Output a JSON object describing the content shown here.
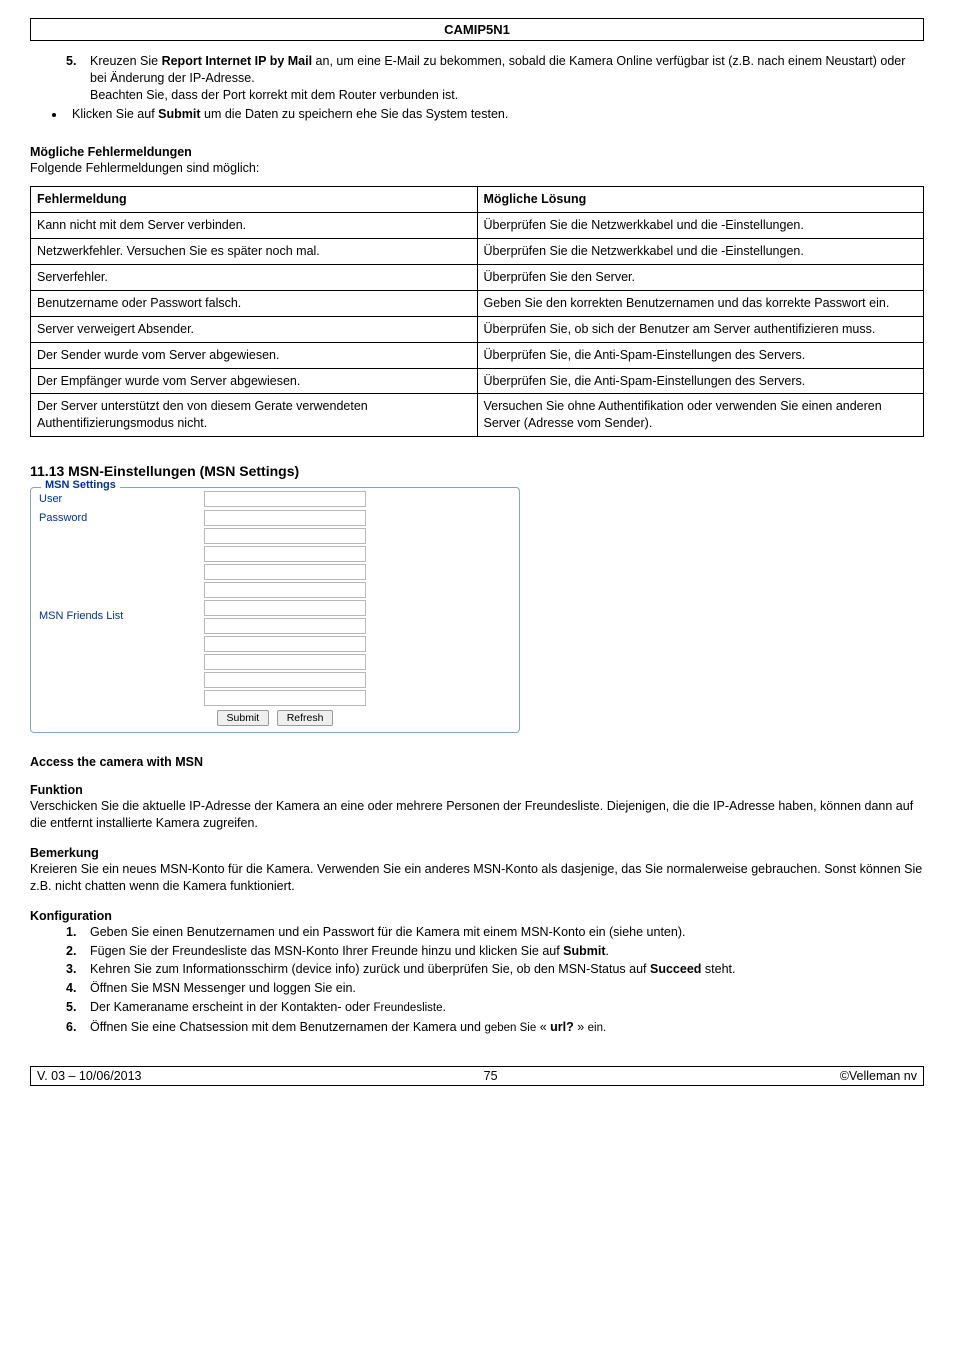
{
  "header": {
    "title": "CAMIP5N1"
  },
  "intro": {
    "num5": "5.",
    "num5_text_a": "Kreuzen Sie ",
    "num5_bold": "Report Internet IP by Mail",
    "num5_text_b": " an, um eine E-Mail zu bekommen, sobald die Kamera Online verfügbar ist (z.B. nach einem Neustart) oder bei Änderung der IP-Adresse.",
    "num5_text_c": "Beachten Sie, dass der Port korrekt mit dem Router verbunden ist.",
    "bullet_a": "Klicken Sie auf ",
    "bullet_bold": "Submit",
    "bullet_b": " um die Daten zu speichern ehe Sie das System testen."
  },
  "errors": {
    "heading": "Mögliche Fehlermeldungen",
    "sub": "Folgende Fehlermeldungen sind möglich:",
    "col1": "Fehlermeldung",
    "col2": "Mögliche Lösung",
    "rows": [
      {
        "c1": "Kann nicht mit dem Server verbinden.",
        "c2": "Überprüfen Sie die Netzwerkkabel und die -Einstellungen."
      },
      {
        "c1": "Netzwerkfehler. Versuchen Sie es später noch mal.",
        "c2": "Überprüfen Sie die Netzwerkkabel und die -Einstellungen."
      },
      {
        "c1": "Serverfehler.",
        "c2": "Überprüfen Sie den Server."
      },
      {
        "c1": "Benutzername oder Passwort falsch.",
        "c2": "Geben Sie den korrekten Benutzernamen und das korrekte Passwort ein."
      },
      {
        "c1": "Server verweigert Absender.",
        "c2": "Überprüfen Sie, ob sich der Benutzer am Server authentifizieren muss."
      },
      {
        "c1": "Der Sender wurde vom Server abgewiesen.",
        "c2": "Überprüfen Sie, die Anti-Spam-Einstellungen des Servers."
      },
      {
        "c1": "Der Empfänger wurde vom Server abgewiesen.",
        "c2": "Überprüfen Sie, die Anti-Spam-Einstellungen des Servers."
      },
      {
        "c1": "Der Server unterstützt den von diesem Gerate verwendeten Authentifizierungsmodus nicht.",
        "c2": "Versuchen Sie ohne Authentifikation oder verwenden Sie einen anderen Server (Adresse vom Sender)."
      }
    ]
  },
  "section_title": "11.13 MSN-Einstellungen (MSN Settings)",
  "msn": {
    "legend": "MSN Settings",
    "user": "User",
    "password": "Password",
    "friends": "MSN Friends List",
    "submit": "Submit",
    "refresh": "Refresh"
  },
  "access": {
    "head": "Access the camera with MSN",
    "funktion_head": "Funktion",
    "funktion_p1": "Verschicken Sie die aktuelle IP-Adresse der Kamera an eine oder mehrere Personen der Freundesliste. Diejenigen, die die IP-Adresse haben, können dann auf die entfernt installierte Kamera zugreifen.",
    "bemerkung_head": "Bemerkung",
    "bemerkung_p1": "Kreieren Sie ein neues MSN-Konto für die Kamera. Verwenden Sie ein anderes MSN-Konto als dasjenige, das Sie normalerweise gebrauchen. Sonst können Sie z.B. nicht chatten wenn die Kamera funktioniert.",
    "konfig_head": "Konfiguration",
    "steps": [
      {
        "n": "1.",
        "t": "Geben Sie einen Benutzernamen und ein Passwort für die Kamera mit einem MSN-Konto ein (siehe unten)."
      },
      {
        "n": "2.",
        "t_a": "Fügen Sie der Freundesliste das MSN-Konto Ihrer Freunde hinzu und klicken Sie auf ",
        "t_bold": "Submit",
        "t_b": "."
      },
      {
        "n": "3.",
        "t_a": "Kehren Sie zum Informationsschirm (device info) zurück und überprüfen Sie, ob den MSN-Status auf ",
        "t_bold": "Succeed",
        "t_b": " steht."
      },
      {
        "n": "4.",
        "t": "Öffnen Sie MSN Messenger und loggen Sie ein."
      },
      {
        "n": "5.",
        "t_a": "Der Kameraname erscheint  in der Kontakten- oder ",
        "t_small": "Freundesliste",
        "t_b": "."
      },
      {
        "n": "6.",
        "t_a": "Öffnen Sie eine Chatsession mit dem Benutzernamen der Kamera und ",
        "t_small": "geben Sie",
        "t_mid": " « ",
        "t_bold": "url?",
        "t_after": " » ",
        "t_small2": "ein."
      }
    ]
  },
  "footer": {
    "left": "V. 03 – 10/06/2013",
    "center": "75",
    "right": "©Velleman nv"
  }
}
